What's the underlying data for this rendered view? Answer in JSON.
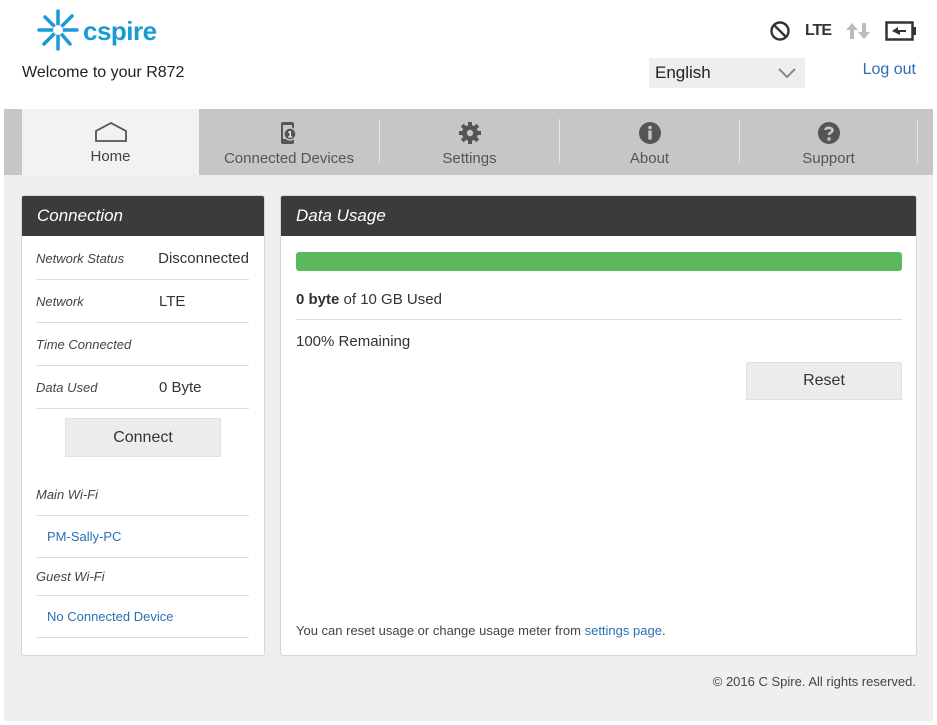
{
  "brand": {
    "name": "cspire",
    "color": "#1a9bd7"
  },
  "header": {
    "welcome": "Welcome to your R872",
    "language": "English",
    "logout": "Log out",
    "status": {
      "signal_icon": "no-signal-icon",
      "network": "LTE",
      "data_icon": "data-arrows-icon",
      "battery_icon": "battery-charging-icon"
    }
  },
  "nav": {
    "tabs": [
      {
        "label": "Home",
        "icon": "home-icon",
        "active": true
      },
      {
        "label": "Connected Devices",
        "icon": "device-icon",
        "badge": "1"
      },
      {
        "label": "Settings",
        "icon": "gear-icon"
      },
      {
        "label": "About",
        "icon": "info-icon"
      },
      {
        "label": "Support",
        "icon": "question-icon"
      }
    ]
  },
  "connection": {
    "title": "Connection",
    "rows": [
      {
        "key": "Network Status",
        "value": "Disconnected"
      },
      {
        "key": "Network",
        "value": "LTE"
      },
      {
        "key": "Time Connected",
        "value": ""
      },
      {
        "key": "Data Used",
        "value": "0 Byte"
      }
    ],
    "connect_label": "Connect",
    "main_wifi_label": "Main Wi-Fi",
    "main_wifi_device": "PM-Sally-PC",
    "guest_wifi_label": "Guest Wi-Fi",
    "guest_wifi_device": "No Connected Device"
  },
  "usage": {
    "title": "Data Usage",
    "remaining_fraction": 1.0,
    "used_amount": "0 byte",
    "used_suffix": " of 10 GB Used",
    "remaining": "100% Remaining",
    "reset_label": "Reset",
    "hint_text": "You can reset usage or change usage meter from ",
    "hint_link": "settings page",
    "hint_end": "."
  },
  "footer": {
    "copyright": "© 2016 C Spire. All rights reserved."
  }
}
